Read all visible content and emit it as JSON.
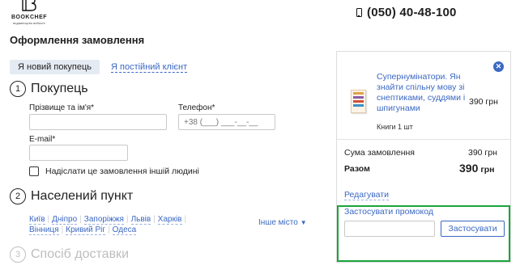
{
  "brand": {
    "name": "BOOKCHEF",
    "tagline": "видавництво вибачте",
    "logo_icon": "bookchef-logo-icon"
  },
  "header": {
    "phone": "(050) 40-48-100",
    "phone_icon": "phone-icon"
  },
  "page": {
    "title": "Оформлення замовлення"
  },
  "tabs": {
    "new_buyer": "Я новий покупець",
    "returning": "Я постійний клієнт"
  },
  "steps": [
    {
      "number": "1",
      "title": "Покупець"
    },
    {
      "number": "2",
      "title": "Населений пункт"
    },
    {
      "number": "3",
      "title": "Спосіб доставки"
    }
  ],
  "form": {
    "name_label": "Прізвище та ім'я*",
    "phone_label": "Телефон*",
    "phone_placeholder": "+38 (___) ___-__-__",
    "email_label": "E-mail*",
    "other_person_label": "Надіслати це замовлення іншій людині"
  },
  "cities": {
    "list": [
      "Київ",
      "Дніпро",
      "Запоріжжя",
      "Львів",
      "Харків",
      "Вінниця",
      "Кривий Ріг",
      "Одеса"
    ],
    "other_label": "Інше місто",
    "other_icon": "chevron-down-icon"
  },
  "cart": {
    "close_icon": "close-icon",
    "book_cover_icon": "book-cover-icon",
    "item_title": "Супернумінатори. Ян знайти спільну мову зі снептиками, суддями і шпигунами",
    "item_price": "390 грн",
    "item_qty": "Книги 1 шт",
    "sum_label": "Сума замовлення",
    "sum_value": "390 грн",
    "total_label": "Разом",
    "total_value": "390",
    "total_currency": "грн",
    "edit_label": "Редагувати",
    "promo_label": "Застосувати промокод",
    "promo_value": "",
    "promo_button": "Застосувати",
    "highlight_color": "#1aa53a"
  },
  "colors": {
    "accent": "#3b68c2",
    "tab_background": "#e5ebf3"
  }
}
